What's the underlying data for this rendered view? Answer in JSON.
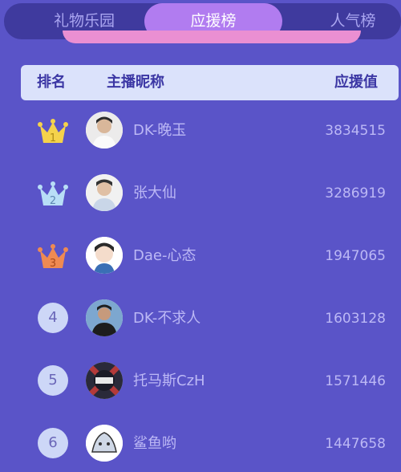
{
  "tabs": [
    {
      "label": "礼物乐园"
    },
    {
      "label": "应援榜"
    },
    {
      "label": "人气榜"
    }
  ],
  "active_tab": "应援榜",
  "table": {
    "headers": {
      "rank": "排名",
      "name": "主播昵称",
      "score": "应援值"
    },
    "rows": [
      {
        "rank": "1",
        "name": "DK-晚玉",
        "score": "3834515",
        "badge": "gold-crown-icon"
      },
      {
        "rank": "2",
        "name": "张大仙",
        "score": "3286919",
        "badge": "silver-crown-icon"
      },
      {
        "rank": "3",
        "name": "Dae-心态",
        "score": "1947065",
        "badge": "bronze-crown-icon"
      },
      {
        "rank": "4",
        "name": "DK-不求人",
        "score": "1603128"
      },
      {
        "rank": "5",
        "name": "托马斯CzH",
        "score": "1571446"
      },
      {
        "rank": "6",
        "name": "鲨鱼哟",
        "score": "1447658"
      }
    ]
  },
  "colors": {
    "background": "#5a54c8",
    "tab_bar": "#3f3a9e",
    "active_tab": "#b17cf0",
    "header_bg": "#dbe2fb",
    "gold": "#f5d24b",
    "silver": "#b8def6",
    "bronze": "#ef8a52"
  }
}
